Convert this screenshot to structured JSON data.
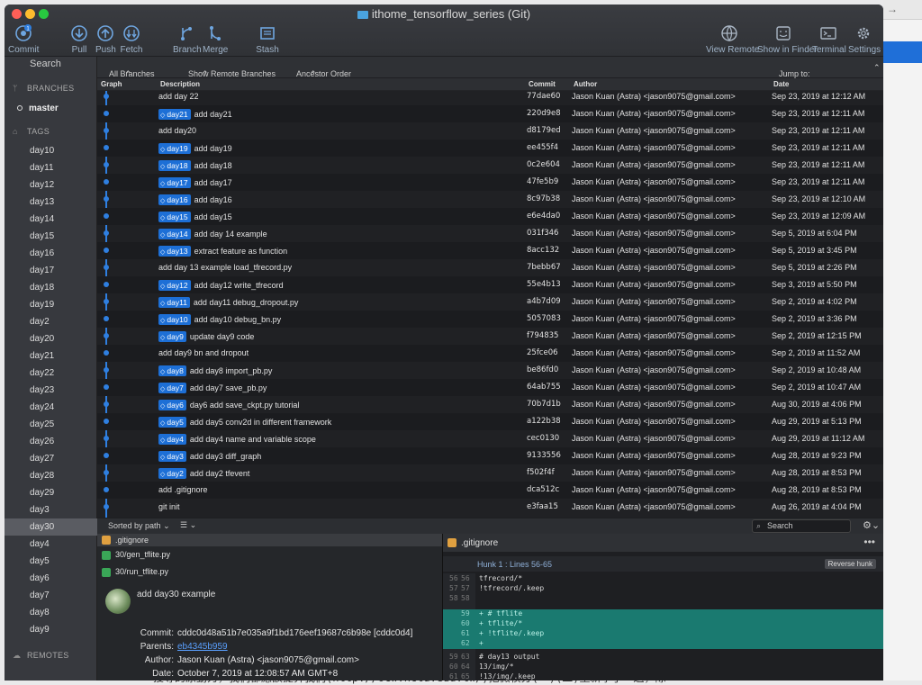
{
  "window": {
    "title": "ithome_tensorflow_series (Git)"
  },
  "toolbar": {
    "commit": {
      "label": "Commit",
      "badge": "1"
    },
    "pull": "Pull",
    "push": "Push",
    "fetch": "Fetch",
    "branch": "Branch",
    "merge": "Merge",
    "stash": "Stash",
    "view_remote": "View Remote",
    "show_in_finder": "Show in Finder",
    "terminal": "Terminal",
    "settings": "Settings"
  },
  "sidebar": {
    "search": "Search",
    "branches_header": "BRANCHES",
    "current_branch": "master",
    "tags_header": "TAGS",
    "tags": [
      "day10",
      "day11",
      "day12",
      "day13",
      "day14",
      "day15",
      "day16",
      "day17",
      "day18",
      "day19",
      "day2",
      "day20",
      "day21",
      "day22",
      "day23",
      "day24",
      "day25",
      "day26",
      "day27",
      "day28",
      "day29",
      "day3",
      "day30",
      "day4",
      "day5",
      "day6",
      "day7",
      "day8",
      "day9"
    ],
    "selected_tag": "day30",
    "remotes_header": "REMOTES"
  },
  "filter": {
    "branches": "All Branches",
    "remote": "Show Remote Branches",
    "order": "Ancestor Order",
    "jump": "Jump to:"
  },
  "table": {
    "headers": {
      "graph": "Graph",
      "description": "Description",
      "commit": "Commit",
      "author": "Author",
      "date": "Date"
    },
    "rows": [
      {
        "tag": "",
        "desc": "add day 22",
        "hash": "77dae60",
        "author": "Jason Kuan (Astra) <jason9075@gmail.com>",
        "date": "Sep 23, 2019 at 12:12 AM"
      },
      {
        "tag": "day21",
        "desc": "add day21",
        "hash": "220d9e8",
        "author": "Jason Kuan (Astra) <jason9075@gmail.com>",
        "date": "Sep 23, 2019 at 12:11 AM"
      },
      {
        "tag": "",
        "desc": "add day20",
        "hash": "d8179ed",
        "author": "Jason Kuan (Astra) <jason9075@gmail.com>",
        "date": "Sep 23, 2019 at 12:11 AM"
      },
      {
        "tag": "day19",
        "desc": "add day19",
        "hash": "ee455f4",
        "author": "Jason Kuan (Astra) <jason9075@gmail.com>",
        "date": "Sep 23, 2019 at 12:11 AM"
      },
      {
        "tag": "day18",
        "desc": "add day18",
        "hash": "0c2e604",
        "author": "Jason Kuan (Astra) <jason9075@gmail.com>",
        "date": "Sep 23, 2019 at 12:11 AM"
      },
      {
        "tag": "day17",
        "desc": "add day17",
        "hash": "47fe5b9",
        "author": "Jason Kuan (Astra) <jason9075@gmail.com>",
        "date": "Sep 23, 2019 at 12:11 AM"
      },
      {
        "tag": "day16",
        "desc": "add day16",
        "hash": "8c97b38",
        "author": "Jason Kuan (Astra) <jason9075@gmail.com>",
        "date": "Sep 23, 2019 at 12:10 AM"
      },
      {
        "tag": "day15",
        "desc": "add day15",
        "hash": "e6e4da0",
        "author": "Jason Kuan (Astra) <jason9075@gmail.com>",
        "date": "Sep 23, 2019 at 12:09 AM"
      },
      {
        "tag": "day14",
        "desc": "add day 14 example",
        "hash": "031f346",
        "author": "Jason Kuan (Astra) <jason9075@gmail.com>",
        "date": "Sep 5, 2019 at 6:04 PM"
      },
      {
        "tag": "day13",
        "desc": "extract feature as function",
        "hash": "8acc132",
        "author": "Jason Kuan (Astra) <jason9075@gmail.com>",
        "date": "Sep 5, 2019 at 3:45 PM"
      },
      {
        "tag": "",
        "desc": "add day 13 example load_tfrecord.py",
        "hash": "7bebb67",
        "author": "Jason Kuan (Astra) <jason9075@gmail.com>",
        "date": "Sep 5, 2019 at 2:26 PM"
      },
      {
        "tag": "day12",
        "desc": "add day12 write_tfrecord",
        "hash": "55e4b13",
        "author": "Jason Kuan (Astra) <jason9075@gmail.com>",
        "date": "Sep 3, 2019 at 5:50 PM"
      },
      {
        "tag": "day11",
        "desc": "add day11 debug_dropout.py",
        "hash": "a4b7d09",
        "author": "Jason Kuan (Astra) <jason9075@gmail.com>",
        "date": "Sep 2, 2019 at 4:02 PM"
      },
      {
        "tag": "day10",
        "desc": "add day10 debug_bn.py",
        "hash": "5057083",
        "author": "Jason Kuan (Astra) <jason9075@gmail.com>",
        "date": "Sep 2, 2019 at 3:36 PM"
      },
      {
        "tag": "day9",
        "desc": "update day9 code",
        "hash": "f794835",
        "author": "Jason Kuan (Astra) <jason9075@gmail.com>",
        "date": "Sep 2, 2019 at 12:15 PM"
      },
      {
        "tag": "",
        "desc": "add day9 bn and dropout",
        "hash": "25fce06",
        "author": "Jason Kuan (Astra) <jason9075@gmail.com>",
        "date": "Sep 2, 2019 at 11:52 AM"
      },
      {
        "tag": "day8",
        "desc": "add day8 import_pb.py",
        "hash": "be86fd0",
        "author": "Jason Kuan (Astra) <jason9075@gmail.com>",
        "date": "Sep 2, 2019 at 10:48 AM"
      },
      {
        "tag": "day7",
        "desc": "add day7 save_pb.py",
        "hash": "64ab755",
        "author": "Jason Kuan (Astra) <jason9075@gmail.com>",
        "date": "Sep 2, 2019 at 10:47 AM"
      },
      {
        "tag": "day6",
        "desc": "day6 add save_ckpt.py tutorial",
        "hash": "70b7d1b",
        "author": "Jason Kuan (Astra) <jason9075@gmail.com>",
        "date": "Aug 30, 2019 at 4:06 PM"
      },
      {
        "tag": "day5",
        "desc": "add day5 conv2d in different framework",
        "hash": "a122b38",
        "author": "Jason Kuan (Astra) <jason9075@gmail.com>",
        "date": "Aug 29, 2019 at 5:13 PM"
      },
      {
        "tag": "day4",
        "desc": "add day4 name and variable scope",
        "hash": "cec0130",
        "author": "Jason Kuan (Astra) <jason9075@gmail.com>",
        "date": "Aug 29, 2019 at 11:12 AM"
      },
      {
        "tag": "day3",
        "desc": "add day3 diff_graph",
        "hash": "9133556",
        "author": "Jason Kuan (Astra) <jason9075@gmail.com>",
        "date": "Aug 28, 2019 at 9:23 PM"
      },
      {
        "tag": "day2",
        "desc": "add day2 tfevent",
        "hash": "f502f4f",
        "author": "Jason Kuan (Astra) <jason9075@gmail.com>",
        "date": "Aug 28, 2019 at 8:53 PM"
      },
      {
        "tag": "",
        "desc": "add .gitignore",
        "hash": "dca512c",
        "author": "Jason Kuan (Astra) <jason9075@gmail.com>",
        "date": "Aug 28, 2019 at 8:53 PM"
      },
      {
        "tag": "",
        "desc": "git init",
        "hash": "e3faa15",
        "author": "Jason Kuan (Astra) <jason9075@gmail.com>",
        "date": "Aug 26, 2019 at 4:04 PM"
      }
    ]
  },
  "lower": {
    "sorted_by": "Sorted by path",
    "search_placeholder": "Search",
    "files": [
      ".gitignore",
      "30/gen_tflite.py",
      "30/run_tflite.py"
    ],
    "commit": {
      "message": "add day30 example",
      "commit_label": "Commit:",
      "commit_value": "cddc0d48a51b7e035a9f1bd176eef19687c6b98e [cddc0d4]",
      "parents_label": "Parents:",
      "parents_value": "eb4345b959",
      "author_label": "Author:",
      "author_value": "Jason Kuan (Astra) <jason9075@gmail.com>",
      "date_label": "Date:",
      "date_value": "October 7, 2019 at 12:08:57 AM GMT+8"
    }
  },
  "diff": {
    "file": ".gitignore",
    "hunk": "Hunk 1 : Lines 56-65",
    "reverse": "Reverse hunk",
    "lines": [
      {
        "n1": "56",
        "n2": "56",
        "code": "tfrecord/*",
        "type": "ctx"
      },
      {
        "n1": "57",
        "n2": "57",
        "code": "!tfrecord/.keep",
        "type": "ctx"
      },
      {
        "n1": "58",
        "n2": "58",
        "code": "",
        "type": "ctx"
      },
      {
        "n1": "",
        "n2": "59",
        "code": "+ # tflite",
        "type": "add"
      },
      {
        "n1": "",
        "n2": "60",
        "code": "+ tflite/*",
        "type": "add"
      },
      {
        "n1": "",
        "n2": "61",
        "code": "+ !tflite/.keep",
        "type": "add"
      },
      {
        "n1": "",
        "n2": "62",
        "code": "+",
        "type": "add"
      },
      {
        "n1": "59",
        "n2": "63",
        "code": "# day13 output",
        "type": "ctx"
      },
      {
        "n1": "60",
        "n2": "64",
        "code": "13/img/*",
        "type": "ctx"
      },
      {
        "n1": "61",
        "n2": "65",
        "code": "!13/img/.keep",
        "type": "ctx"
      }
    ]
  },
  "background": {
    "bottom_text": "搜尋的原動力，我們都應該提昇我們(http://ocw.nctu.edu.tw/)把微積分(一)(二)重新學了一遍，除"
  },
  "colors": {
    "accent": "#1d6fd6",
    "add_bg": "#1a7a70"
  }
}
